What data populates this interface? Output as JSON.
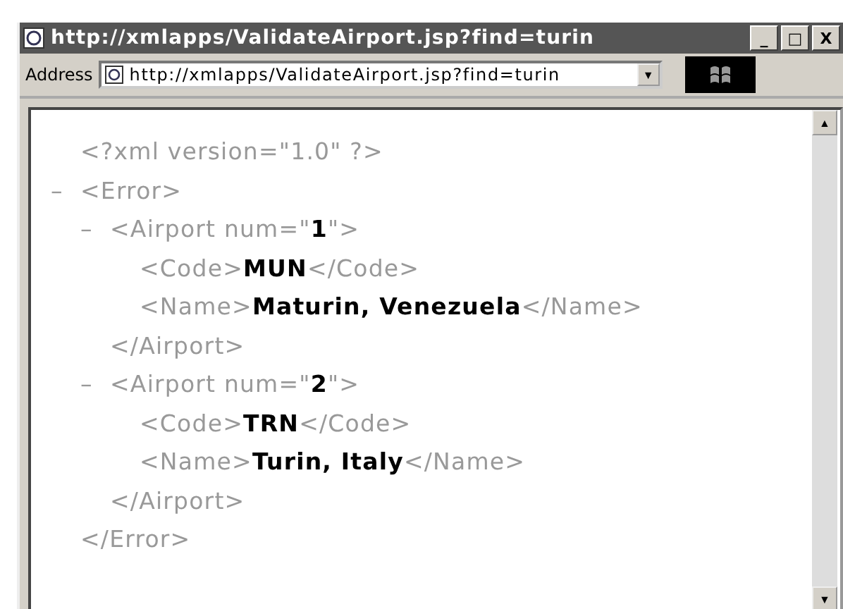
{
  "window": {
    "title": "http://xmlapps/ValidateAirport.jsp?find=turin",
    "controls": [
      "_",
      "□",
      "X"
    ]
  },
  "address_bar": {
    "label": "Address",
    "value": "http://xmlapps/ValidateAirport.jsp?find=turin",
    "dropdown": "▼"
  },
  "document": [
    {
      "text": "<?xml version=\"1.0\" ?>"
    },
    {
      "toggle": "–",
      "open": "<Error>",
      "close": "</Error>",
      "children": [
        {
          "toggle": "–",
          "open": "<Airport num=\"**1**\">",
          "close": "</Airport>",
          "children": [
            {
              "text": "<Code>**MUN**</Code>"
            },
            {
              "text": "<Name>**Maturin, Venezuela**</Name>"
            }
          ]
        },
        {
          "toggle": "–",
          "open": "<Airport num=\"**2**\">",
          "close": "</Airport>",
          "children": [
            {
              "text": "<Code>**TRN**</Code>"
            },
            {
              "text": "<Name>**Turin, Italy**</Name>"
            }
          ]
        }
      ]
    }
  ],
  "scrollbar": {
    "up": "▲",
    "down": "▼"
  }
}
